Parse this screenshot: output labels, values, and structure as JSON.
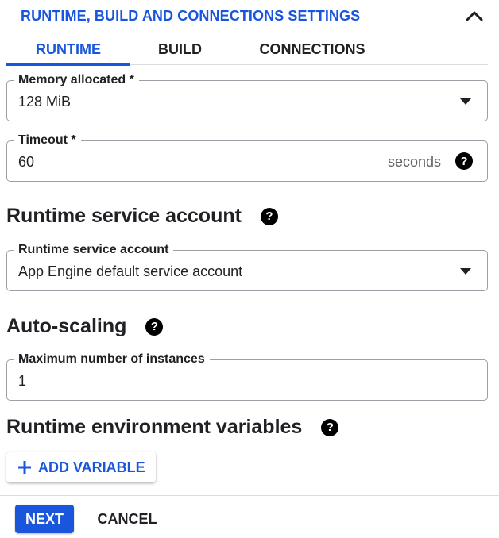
{
  "section": {
    "title": "RUNTIME, BUILD AND CONNECTIONS SETTINGS",
    "collapse_icon": "chevron-up-icon"
  },
  "tabs": [
    {
      "label": "RUNTIME",
      "active": true
    },
    {
      "label": "BUILD",
      "active": false
    },
    {
      "label": "CONNECTIONS",
      "active": false
    }
  ],
  "memory": {
    "label": "Memory allocated *",
    "value": "128 MiB",
    "icon": "dropdown-arrow-icon"
  },
  "timeout": {
    "label": "Timeout *",
    "value": "60",
    "suffix": "seconds",
    "help_icon": "help-icon"
  },
  "service_account": {
    "heading": "Runtime service account",
    "label": "Runtime service account",
    "value": "App Engine default service account",
    "icon": "dropdown-arrow-icon"
  },
  "autoscaling": {
    "heading": "Auto-scaling",
    "label": "Maximum number of instances",
    "value": "1"
  },
  "env_vars": {
    "heading": "Runtime environment variables",
    "add_label": "ADD VARIABLE",
    "add_icon": "plus-icon"
  },
  "footer": {
    "next_label": "NEXT",
    "cancel_label": "CANCEL"
  },
  "colors": {
    "accent": "#1a56db",
    "text": "#202124",
    "border": "#9aa0a6"
  }
}
